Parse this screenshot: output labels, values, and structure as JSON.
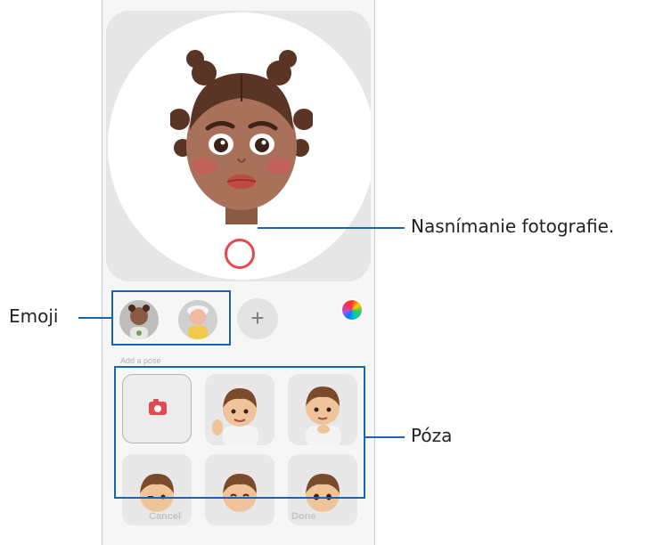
{
  "callouts": {
    "capture": "Nasnímanie fotografie.",
    "emoji": "Emoji",
    "pose": "Póza"
  },
  "pose_section": {
    "title": "Add a pose"
  },
  "bottom_bar": {
    "cancel": "Cancel",
    "done": "Done"
  },
  "add_emoji_symbol": "+",
  "icons": {
    "shutter": "shutter-icon",
    "color": "color-wheel-icon",
    "camera": "camera-icon"
  },
  "colors": {
    "accent": "#1766b5",
    "shutter": "#e5484d"
  }
}
